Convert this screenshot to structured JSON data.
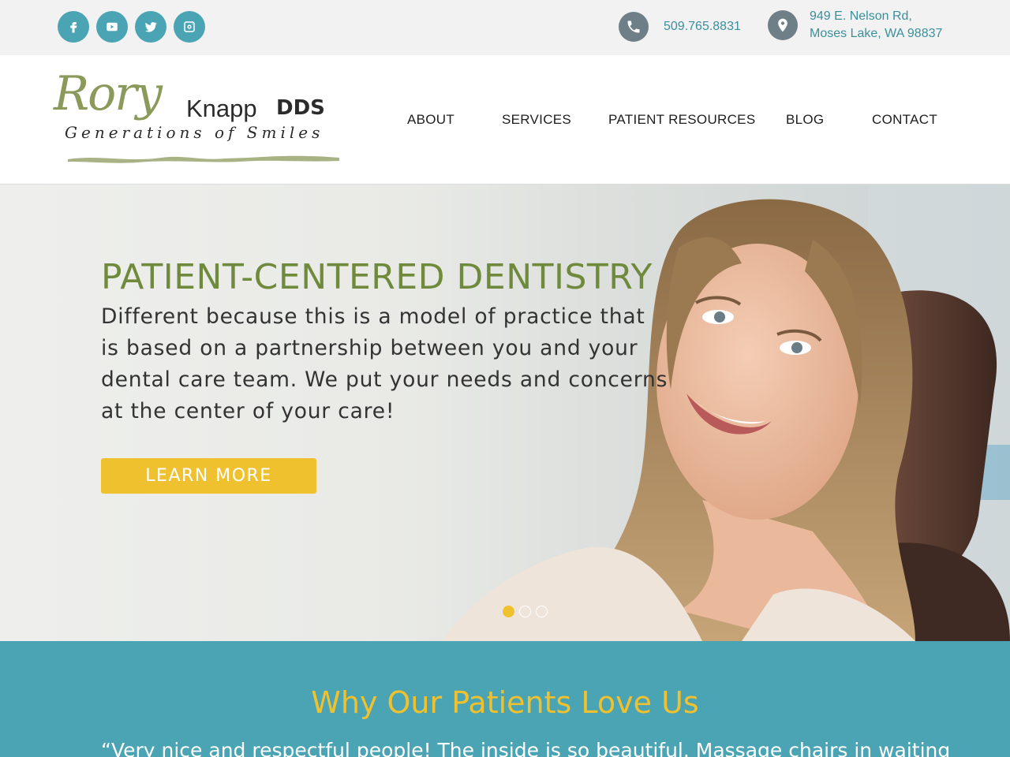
{
  "topbar": {
    "social": [
      {
        "icon": "facebook-icon",
        "name": "facebook"
      },
      {
        "icon": "youtube-icon",
        "name": "youtube"
      },
      {
        "icon": "twitter-icon",
        "name": "twitter"
      },
      {
        "icon": "instagram-icon",
        "name": "instagram"
      }
    ],
    "phone": "509.765.8831",
    "address_line1": "949 E. Nelson Rd,",
    "address_line2": "Moses Lake, WA 98837"
  },
  "logo": {
    "script": "Rory",
    "name": "Knapp",
    "suffix": "DDS",
    "tagline": "Generations of Smiles"
  },
  "nav": {
    "items": [
      "ABOUT",
      "SERVICES",
      "PATIENT RESOURCES",
      "BLOG",
      "CONTACT"
    ]
  },
  "hero": {
    "title": "PATIENT-CENTERED DENTISTRY",
    "text": "Different because this is a model of practice that is based on a partnership between you and your dental care team. We put your needs and concerns at the center of your care!",
    "button": "LEARN MORE",
    "slides_total": 3,
    "slide_active": 1
  },
  "reviews": {
    "title": "Why Our Patients Love Us",
    "quote": "“Very nice and respectful people! The inside is so beautiful. Massage chairs in waiting"
  },
  "colors": {
    "teal": "#4aa4b4",
    "olive": "#6f8a3c",
    "yellow": "#f0c12e",
    "topbar_bg": "#f2f2f2"
  }
}
